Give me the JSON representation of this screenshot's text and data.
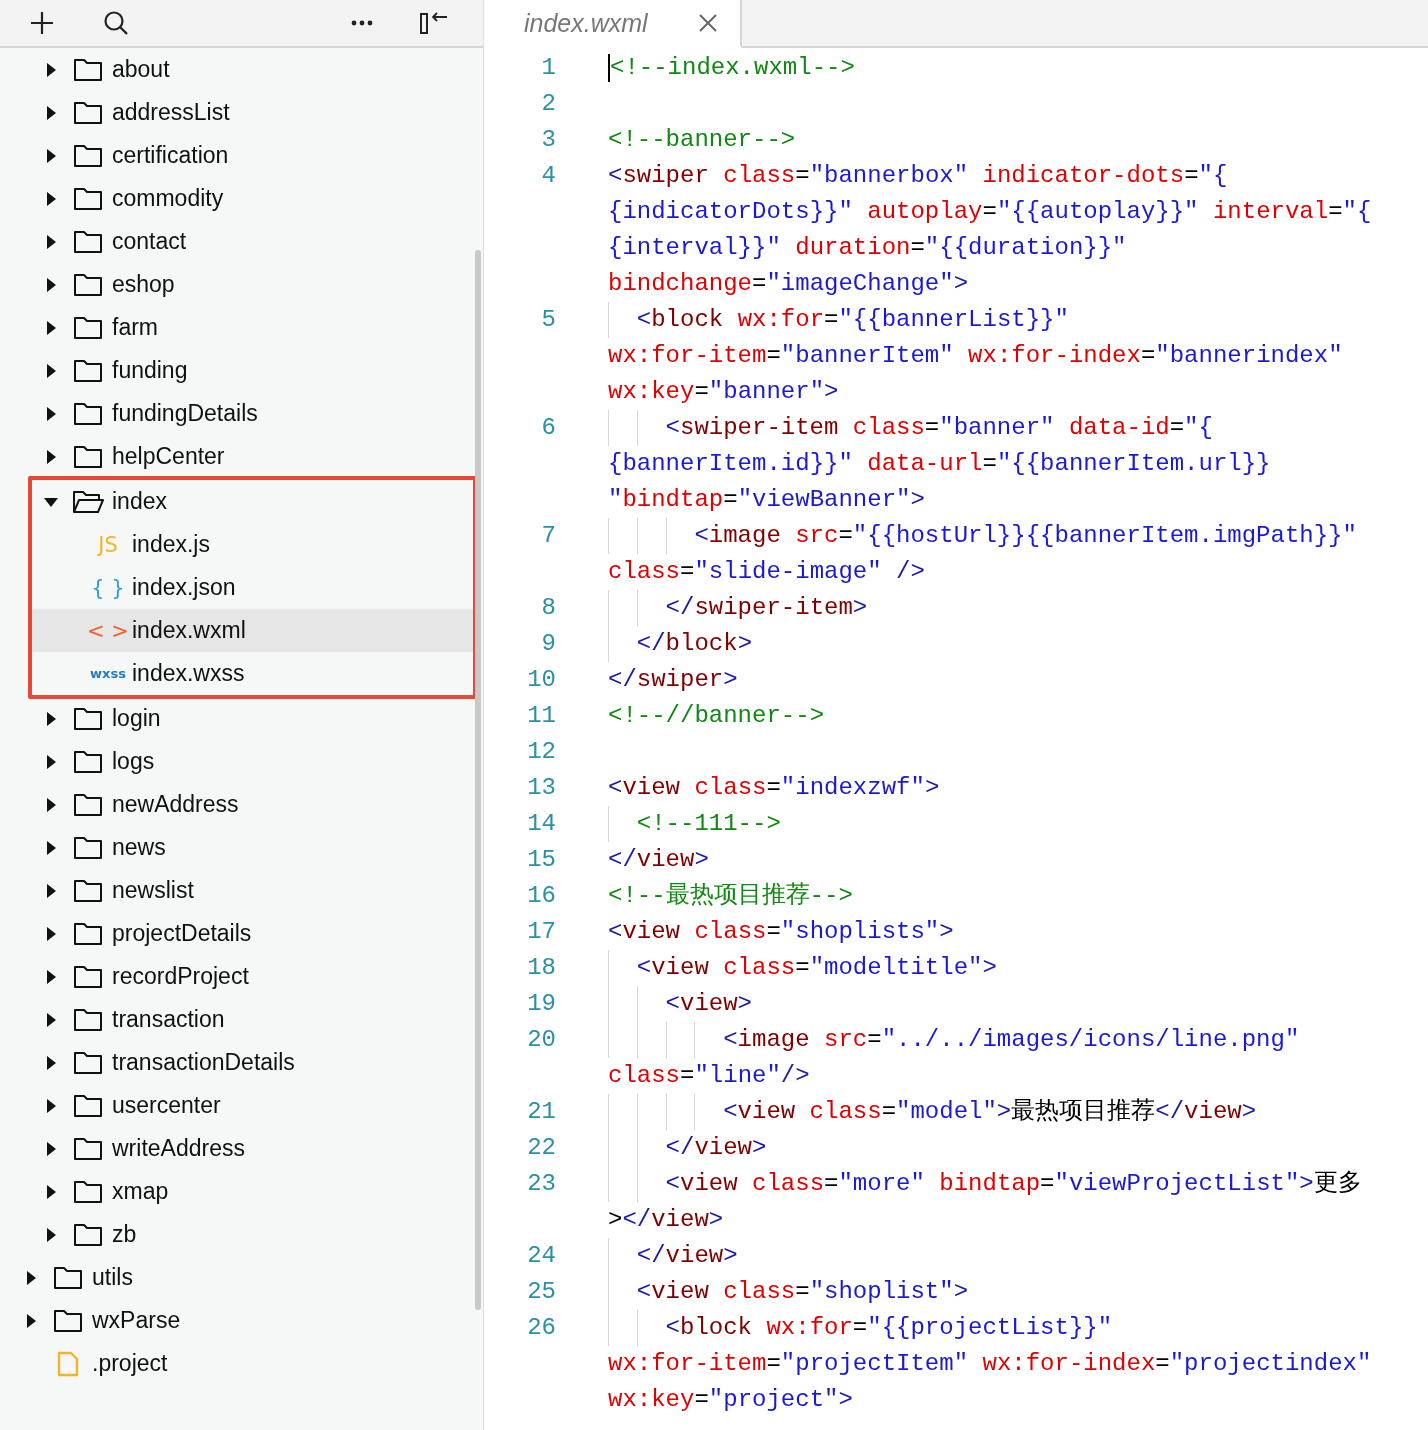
{
  "toolbar": {
    "buttons": [
      {
        "kind": "add"
      },
      {
        "kind": "search"
      },
      {
        "kind": "more"
      },
      {
        "kind": "collapse"
      }
    ]
  },
  "tree": {
    "partial_children": [
      {
        "label": "about",
        "kind": "folder",
        "expanded": false,
        "selected": false,
        "outlined": false
      },
      {
        "label": "addressList",
        "kind": "folder",
        "expanded": false,
        "selected": false,
        "outlined": false
      },
      {
        "label": "certification",
        "kind": "folder",
        "expanded": false,
        "selected": false,
        "outlined": false
      },
      {
        "label": "commodity",
        "kind": "folder",
        "expanded": false,
        "selected": false,
        "outlined": false
      },
      {
        "label": "contact",
        "kind": "folder",
        "expanded": false,
        "selected": false,
        "outlined": false
      },
      {
        "label": "eshop",
        "kind": "folder",
        "expanded": false,
        "selected": false,
        "outlined": false
      },
      {
        "label": "farm",
        "kind": "folder",
        "expanded": false,
        "selected": false,
        "outlined": false
      },
      {
        "label": "funding",
        "kind": "folder",
        "expanded": false,
        "selected": false,
        "outlined": false
      },
      {
        "label": "fundingDetails",
        "kind": "folder",
        "expanded": false,
        "selected": false,
        "outlined": false
      },
      {
        "label": "helpCenter",
        "kind": "folder",
        "expanded": false,
        "selected": false,
        "outlined": false
      },
      {
        "label": "index",
        "kind": "folder",
        "expanded": true,
        "selected": false,
        "outlined": true,
        "children": [
          {
            "label": "index.js",
            "kind": "file",
            "badge": "JS",
            "color": "#f0b429",
            "selected": false
          },
          {
            "label": "index.json",
            "kind": "file",
            "badge": "{ }",
            "color": "#2a9fd8",
            "selected": false
          },
          {
            "label": "index.wxml",
            "kind": "file",
            "badge": "< >",
            "color": "#e8642c",
            "selected": true
          },
          {
            "label": "index.wxss",
            "kind": "file",
            "badge": "wxss",
            "color": "#1f7fc4",
            "selected": false
          }
        ]
      },
      {
        "label": "login",
        "kind": "folder",
        "expanded": false,
        "selected": false,
        "outlined": false
      },
      {
        "label": "logs",
        "kind": "folder",
        "expanded": false,
        "selected": false,
        "outlined": false
      },
      {
        "label": "newAddress",
        "kind": "folder",
        "expanded": false,
        "selected": false,
        "outlined": false
      },
      {
        "label": "news",
        "kind": "folder",
        "expanded": false,
        "selected": false,
        "outlined": false
      },
      {
        "label": "newslist",
        "kind": "folder",
        "expanded": false,
        "selected": false,
        "outlined": false
      },
      {
        "label": "projectDetails",
        "kind": "folder",
        "expanded": false,
        "selected": false,
        "outlined": false
      },
      {
        "label": "recordProject",
        "kind": "folder",
        "expanded": false,
        "selected": false,
        "outlined": false
      },
      {
        "label": "transaction",
        "kind": "folder",
        "expanded": false,
        "selected": false,
        "outlined": false
      },
      {
        "label": "transactionDetails",
        "kind": "folder",
        "expanded": false,
        "selected": false,
        "outlined": false
      },
      {
        "label": "usercenter",
        "kind": "folder",
        "expanded": false,
        "selected": false,
        "outlined": false
      },
      {
        "label": "writeAddress",
        "kind": "folder",
        "expanded": false,
        "selected": false,
        "outlined": false
      },
      {
        "label": "xmap",
        "kind": "folder",
        "expanded": false,
        "selected": false,
        "outlined": false
      },
      {
        "label": "zb",
        "kind": "folder",
        "expanded": false,
        "selected": false,
        "outlined": false
      }
    ],
    "items": [
      {
        "label": "utils",
        "kind": "folder",
        "expanded": false,
        "selected": false,
        "outlined": false
      },
      {
        "label": "wxParse",
        "kind": "folder",
        "expanded": false,
        "selected": false,
        "outlined": false
      },
      {
        "label": ".project",
        "kind": "page",
        "selected": false,
        "outlined": false
      }
    ]
  },
  "tabs": [
    {
      "label": "index.wxml",
      "selected": true
    }
  ],
  "code": [
    {
      "number": "1",
      "cursor": true,
      "rows": [
        {
          "tokens": [
            {
              "kind": "comment",
              "text": "<!--index.wxml-->"
            }
          ]
        }
      ]
    },
    {
      "number": "2",
      "cursor": false
    },
    {
      "number": "3",
      "cursor": false,
      "rows": [
        {
          "tokens": [
            {
              "kind": "comment",
              "text": "<!--banner-->"
            }
          ]
        }
      ]
    },
    {
      "number": "4",
      "cursor": false,
      "rows": [
        {
          "tokens": [
            {
              "kind": "punct",
              "text": "<"
            },
            {
              "kind": "tag",
              "text": "swiper "
            },
            {
              "kind": "attr",
              "text": "class"
            },
            {
              "kind": "text",
              "text": "="
            },
            {
              "kind": "string",
              "text": "\"bannerbox\" "
            },
            {
              "kind": "attr",
              "text": "indicator-dots"
            },
            {
              "kind": "text",
              "text": "="
            },
            {
              "kind": "string",
              "text": "\"{"
            }
          ]
        },
        {
          "tokens": [
            {
              "kind": "string",
              "text": "{indicatorDots}}\" "
            },
            {
              "kind": "attr",
              "text": "autoplay"
            },
            {
              "kind": "text",
              "text": "="
            },
            {
              "kind": "string",
              "text": "\"{{autoplay}}\" "
            },
            {
              "kind": "attr",
              "text": "interval"
            },
            {
              "kind": "text",
              "text": "="
            },
            {
              "kind": "string",
              "text": "\"{"
            }
          ]
        },
        {
          "tokens": [
            {
              "kind": "string",
              "text": "{interval}}\" "
            },
            {
              "kind": "attr",
              "text": "duration"
            },
            {
              "kind": "text",
              "text": "="
            },
            {
              "kind": "string",
              "text": "\"{{duration}}\""
            }
          ]
        },
        {
          "tokens": [
            {
              "kind": "attr",
              "text": "bindchange"
            },
            {
              "kind": "text",
              "text": "="
            },
            {
              "kind": "string",
              "text": "\"imageChange\""
            },
            {
              "kind": "punct",
              "text": ">"
            }
          ]
        }
      ]
    },
    {
      "number": "5",
      "cursor": false,
      "rows": [
        {
          "tokens": [
            {
              "kind": "guide"
            },
            {
              "kind": "punct",
              "text": "<"
            },
            {
              "kind": "tag",
              "text": "block "
            },
            {
              "kind": "attr",
              "text": "wx:for"
            },
            {
              "kind": "text",
              "text": "="
            },
            {
              "kind": "string",
              "text": "\"{{bannerList}}\""
            }
          ]
        },
        {
          "tokens": [
            {
              "kind": "attr",
              "text": "wx:for-item"
            },
            {
              "kind": "text",
              "text": "="
            },
            {
              "kind": "string",
              "text": "\"bannerItem\" "
            },
            {
              "kind": "attr",
              "text": "wx:for-index"
            },
            {
              "kind": "text",
              "text": "="
            },
            {
              "kind": "string",
              "text": "\"bannerindex\""
            }
          ]
        },
        {
          "tokens": [
            {
              "kind": "attr",
              "text": "wx:key"
            },
            {
              "kind": "text",
              "text": "="
            },
            {
              "kind": "string",
              "text": "\"banner\""
            },
            {
              "kind": "punct",
              "text": ">"
            }
          ]
        }
      ]
    },
    {
      "number": "6",
      "cursor": false,
      "rows": [
        {
          "tokens": [
            {
              "kind": "guide"
            },
            {
              "kind": "guide"
            },
            {
              "kind": "punct",
              "text": "<"
            },
            {
              "kind": "tag",
              "text": "swiper-item "
            },
            {
              "kind": "attr",
              "text": "class"
            },
            {
              "kind": "text",
              "text": "="
            },
            {
              "kind": "string",
              "text": "\"banner\" "
            },
            {
              "kind": "attr",
              "text": "data-id"
            },
            {
              "kind": "text",
              "text": "="
            },
            {
              "kind": "string",
              "text": "\"{"
            }
          ]
        },
        {
          "tokens": [
            {
              "kind": "string",
              "text": "{bannerItem.id}}\" "
            },
            {
              "kind": "attr",
              "text": "data-url"
            },
            {
              "kind": "text",
              "text": "="
            },
            {
              "kind": "string",
              "text": "\"{{bannerItem.url}}"
            }
          ]
        },
        {
          "tokens": [
            {
              "kind": "string",
              "text": "\""
            },
            {
              "kind": "attr",
              "text": "bindtap"
            },
            {
              "kind": "text",
              "text": "="
            },
            {
              "kind": "string",
              "text": "\"viewBanner\""
            },
            {
              "kind": "punct",
              "text": ">"
            }
          ]
        }
      ]
    },
    {
      "number": "7",
      "cursor": false,
      "rows": [
        {
          "tokens": [
            {
              "kind": "guide"
            },
            {
              "kind": "guide"
            },
            {
              "kind": "guide"
            },
            {
              "kind": "punct",
              "text": "<"
            },
            {
              "kind": "tag",
              "text": "image "
            },
            {
              "kind": "attr",
              "text": "src"
            },
            {
              "kind": "text",
              "text": "="
            },
            {
              "kind": "string",
              "text": "\"{{hostUrl}}{{bannerItem.imgPath}}\""
            }
          ]
        },
        {
          "tokens": [
            {
              "kind": "attr",
              "text": "class"
            },
            {
              "kind": "text",
              "text": "="
            },
            {
              "kind": "string",
              "text": "\"slide-image\" "
            },
            {
              "kind": "punct",
              "text": "/>"
            }
          ]
        }
      ]
    },
    {
      "number": "8",
      "cursor": false,
      "rows": [
        {
          "tokens": [
            {
              "kind": "guide"
            },
            {
              "kind": "guide"
            },
            {
              "kind": "punct",
              "text": "</"
            },
            {
              "kind": "tag",
              "text": "swiper-item"
            },
            {
              "kind": "punct",
              "text": ">"
            }
          ]
        }
      ]
    },
    {
      "number": "9",
      "cursor": false,
      "rows": [
        {
          "tokens": [
            {
              "kind": "guide"
            },
            {
              "kind": "punct",
              "text": "</"
            },
            {
              "kind": "tag",
              "text": "block"
            },
            {
              "kind": "punct",
              "text": ">"
            }
          ]
        }
      ]
    },
    {
      "number": "10",
      "cursor": false,
      "rows": [
        {
          "tokens": [
            {
              "kind": "punct",
              "text": "</"
            },
            {
              "kind": "tag",
              "text": "swiper"
            },
            {
              "kind": "punct",
              "text": ">"
            }
          ]
        }
      ]
    },
    {
      "number": "11",
      "cursor": false,
      "rows": [
        {
          "tokens": [
            {
              "kind": "comment",
              "text": "<!--//banner-->"
            }
          ]
        }
      ]
    },
    {
      "number": "12",
      "cursor": false
    },
    {
      "number": "13",
      "cursor": false,
      "rows": [
        {
          "tokens": [
            {
              "kind": "punct",
              "text": "<"
            },
            {
              "kind": "tag",
              "text": "view "
            },
            {
              "kind": "attr",
              "text": "class"
            },
            {
              "kind": "text",
              "text": "="
            },
            {
              "kind": "string",
              "text": "\"indexzwf\""
            },
            {
              "kind": "punct",
              "text": ">"
            }
          ]
        }
      ]
    },
    {
      "number": "14",
      "cursor": false,
      "rows": [
        {
          "tokens": [
            {
              "kind": "guide"
            },
            {
              "kind": "comment",
              "text": "<!--111-->"
            }
          ]
        }
      ]
    },
    {
      "number": "15",
      "cursor": false,
      "rows": [
        {
          "tokens": [
            {
              "kind": "punct",
              "text": "</"
            },
            {
              "kind": "tag",
              "text": "view"
            },
            {
              "kind": "punct",
              "text": ">"
            }
          ]
        }
      ]
    },
    {
      "number": "16",
      "cursor": false,
      "rows": [
        {
          "tokens": [
            {
              "kind": "comment",
              "text": "<!--最热项目推荐-->"
            }
          ]
        }
      ]
    },
    {
      "number": "17",
      "cursor": false,
      "rows": [
        {
          "tokens": [
            {
              "kind": "punct",
              "text": "<"
            },
            {
              "kind": "tag",
              "text": "view "
            },
            {
              "kind": "attr",
              "text": "class"
            },
            {
              "kind": "text",
              "text": "="
            },
            {
              "kind": "string",
              "text": "\"shoplists\""
            },
            {
              "kind": "punct",
              "text": ">"
            }
          ]
        }
      ]
    },
    {
      "number": "18",
      "cursor": false,
      "rows": [
        {
          "tokens": [
            {
              "kind": "guide"
            },
            {
              "kind": "punct",
              "text": "<"
            },
            {
              "kind": "tag",
              "text": "view "
            },
            {
              "kind": "attr",
              "text": "class"
            },
            {
              "kind": "text",
              "text": "="
            },
            {
              "kind": "string",
              "text": "\"modeltitle\""
            },
            {
              "kind": "punct",
              "text": ">"
            }
          ]
        }
      ]
    },
    {
      "number": "19",
      "cursor": false,
      "rows": [
        {
          "tokens": [
            {
              "kind": "guide"
            },
            {
              "kind": "guide"
            },
            {
              "kind": "punct",
              "text": "<"
            },
            {
              "kind": "tag",
              "text": "view"
            },
            {
              "kind": "punct",
              "text": ">"
            }
          ]
        }
      ]
    },
    {
      "number": "20",
      "cursor": false,
      "rows": [
        {
          "tokens": [
            {
              "kind": "guide"
            },
            {
              "kind": "guide"
            },
            {
              "kind": "guide"
            },
            {
              "kind": "guide"
            },
            {
              "kind": "punct",
              "text": "<"
            },
            {
              "kind": "tag",
              "text": "image "
            },
            {
              "kind": "attr",
              "text": "src"
            },
            {
              "kind": "text",
              "text": "="
            },
            {
              "kind": "string",
              "text": "\"../../images/icons/line.png\""
            }
          ]
        },
        {
          "tokens": [
            {
              "kind": "attr",
              "text": "class"
            },
            {
              "kind": "text",
              "text": "="
            },
            {
              "kind": "string",
              "text": "\"line\""
            },
            {
              "kind": "punct",
              "text": "/>"
            }
          ]
        }
      ]
    },
    {
      "number": "21",
      "cursor": false,
      "rows": [
        {
          "tokens": [
            {
              "kind": "guide"
            },
            {
              "kind": "guide"
            },
            {
              "kind": "guide"
            },
            {
              "kind": "guide"
            },
            {
              "kind": "punct",
              "text": "<"
            },
            {
              "kind": "tag",
              "text": "view "
            },
            {
              "kind": "attr",
              "text": "class"
            },
            {
              "kind": "text",
              "text": "="
            },
            {
              "kind": "string",
              "text": "\"model\""
            },
            {
              "kind": "punct",
              "text": ">"
            },
            {
              "kind": "text",
              "text": "最热项目推荐"
            },
            {
              "kind": "punct",
              "text": "</"
            },
            {
              "kind": "tag",
              "text": "view"
            },
            {
              "kind": "punct",
              "text": ">"
            }
          ]
        }
      ]
    },
    {
      "number": "22",
      "cursor": false,
      "rows": [
        {
          "tokens": [
            {
              "kind": "guide"
            },
            {
              "kind": "guide"
            },
            {
              "kind": "punct",
              "text": "</"
            },
            {
              "kind": "tag",
              "text": "view"
            },
            {
              "kind": "punct",
              "text": ">"
            }
          ]
        }
      ]
    },
    {
      "number": "23",
      "cursor": false,
      "rows": [
        {
          "tokens": [
            {
              "kind": "guide"
            },
            {
              "kind": "guide"
            },
            {
              "kind": "punct",
              "text": "<"
            },
            {
              "kind": "tag",
              "text": "view "
            },
            {
              "kind": "attr",
              "text": "class"
            },
            {
              "kind": "text",
              "text": "="
            },
            {
              "kind": "string",
              "text": "\"more\" "
            },
            {
              "kind": "attr",
              "text": "bindtap"
            },
            {
              "kind": "text",
              "text": "="
            },
            {
              "kind": "string",
              "text": "\"viewProjectList\""
            },
            {
              "kind": "punct",
              "text": ">"
            },
            {
              "kind": "text",
              "text": "更多"
            }
          ]
        },
        {
          "tokens": [
            {
              "kind": "text",
              "text": ">"
            },
            {
              "kind": "punct",
              "text": "</"
            },
            {
              "kind": "tag",
              "text": "view"
            },
            {
              "kind": "punct",
              "text": ">"
            }
          ]
        }
      ]
    },
    {
      "number": "24",
      "cursor": false,
      "rows": [
        {
          "tokens": [
            {
              "kind": "guide"
            },
            {
              "kind": "punct",
              "text": "</"
            },
            {
              "kind": "tag",
              "text": "view"
            },
            {
              "kind": "punct",
              "text": ">"
            }
          ]
        }
      ]
    },
    {
      "number": "25",
      "cursor": false,
      "rows": [
        {
          "tokens": [
            {
              "kind": "guide"
            },
            {
              "kind": "punct",
              "text": "<"
            },
            {
              "kind": "tag",
              "text": "view "
            },
            {
              "kind": "attr",
              "text": "class"
            },
            {
              "kind": "text",
              "text": "="
            },
            {
              "kind": "string",
              "text": "\"shoplist\""
            },
            {
              "kind": "punct",
              "text": ">"
            }
          ]
        }
      ]
    },
    {
      "number": "26",
      "cursor": false,
      "rows": [
        {
          "tokens": [
            {
              "kind": "guide"
            },
            {
              "kind": "guide"
            },
            {
              "kind": "punct",
              "text": "<"
            },
            {
              "kind": "tag",
              "text": "block "
            },
            {
              "kind": "attr",
              "text": "wx:for"
            },
            {
              "kind": "text",
              "text": "="
            },
            {
              "kind": "string",
              "text": "\"{{projectList}}\""
            }
          ]
        },
        {
          "tokens": [
            {
              "kind": "attr",
              "text": "wx:for-item"
            },
            {
              "kind": "text",
              "text": "="
            },
            {
              "kind": "string",
              "text": "\"projectItem\" "
            },
            {
              "kind": "attr",
              "text": "wx:for-index"
            },
            {
              "kind": "text",
              "text": "="
            },
            {
              "kind": "string",
              "text": "\"projectindex\""
            }
          ]
        },
        {
          "tokens": [
            {
              "kind": "attr",
              "text": "wx:key"
            },
            {
              "kind": "text",
              "text": "="
            },
            {
              "kind": "string",
              "text": "\"project\""
            },
            {
              "kind": "punct",
              "text": ">"
            }
          ]
        }
      ]
    }
  ]
}
